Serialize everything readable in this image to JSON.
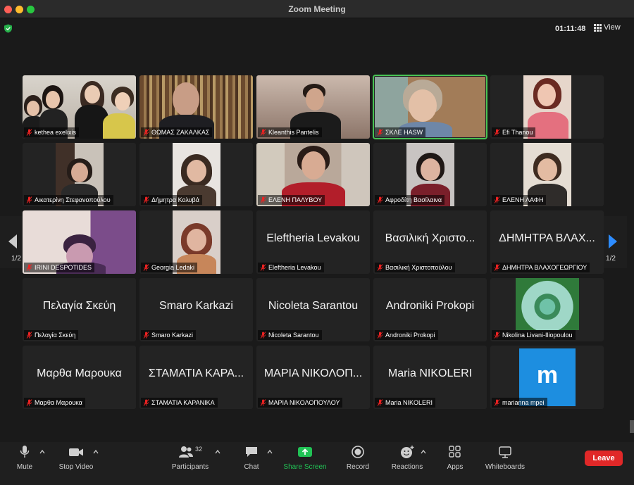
{
  "window": {
    "title": "Zoom Meeting"
  },
  "topbar": {
    "timer": "01:11:48",
    "view_label": "View"
  },
  "pager": {
    "left_label": "1/2",
    "right_label": "1/2"
  },
  "tiles": [
    {
      "name": "kethea exelixis"
    },
    {
      "name": "ΘΩΜΑΣ ΖΑΚΑΛΚΑΣ"
    },
    {
      "name": "Kleanthis Pantelis"
    },
    {
      "name": "ΣΚΛΕ HASW"
    },
    {
      "name": "Efi Thanou"
    },
    {
      "name": "Αικατερίνη Στεφανοπούλου"
    },
    {
      "name": "Δήμητρα Κολυβά"
    },
    {
      "name": "ΕΛΕΝΗ ΠΑΛΥΒΟΥ"
    },
    {
      "name": "Αφροδίτη Βασίλαινα"
    },
    {
      "name": "ΕΛΕΝΗ ΛΑΦΗ"
    },
    {
      "name": "IRINI DESPOTIDES"
    },
    {
      "name": "Georgia Ledaki"
    },
    {
      "name": "Eleftheria Levakou",
      "big": "Eleftheria Levakou"
    },
    {
      "name": "Βασιλική Χριστοπούλου",
      "big": "Βασιλική Χριστο..."
    },
    {
      "name": "ΔΗΜΗΤΡΑ ΒΛΑΧΟΓΕΩΡΓΙΟΥ",
      "big": "ΔΗΜΗΤΡΑ ΒΛΑΧ..."
    },
    {
      "name": "Πελαγία Σκεύη",
      "big": "Πελαγία Σκεύη"
    },
    {
      "name": "Smaro Karkazi",
      "big": "Smaro Karkazi"
    },
    {
      "name": "Nicoleta Sarantou",
      "big": "Nicoleta Sarantou"
    },
    {
      "name": "Androniki Prokopi",
      "big": "Androniki Prokopi"
    },
    {
      "name": "Nikolina Livani-Iliopoulou"
    },
    {
      "name": "Μαρθα Μαρουκα",
      "big": "Μαρθα Μαρουκα"
    },
    {
      "name": "ΣΤΑΜΑΤΙΑ ΚΑΡΑΝΙΚΑ",
      "big": "ΣΤΑΜΑΤΙΑ ΚΑΡΑ..."
    },
    {
      "name": "ΜΑΡΙΑ ΝΙΚΟΛΟΠΟΥΛΟΥ",
      "big": "ΜΑΡΙΑ ΝΙΚΟΛΟΠ..."
    },
    {
      "name": "Maria NIKOLERI",
      "big": "Maria NIKOLERI"
    },
    {
      "name": "marianna mpei",
      "avatar_letter": "m"
    }
  ],
  "toolbar": {
    "mute": "Mute",
    "stop_video": "Stop Video",
    "participants": "Participants",
    "participants_count": "32",
    "chat": "Chat",
    "share_screen": "Share Screen",
    "record": "Record",
    "reactions": "Reactions",
    "apps": "Apps",
    "whiteboards": "Whiteboards",
    "leave": "Leave"
  },
  "colors": {
    "active_speaker": "#47c253",
    "share_green": "#21c255",
    "leave_red": "#e02828",
    "accent_blue": "#2d8cff"
  }
}
